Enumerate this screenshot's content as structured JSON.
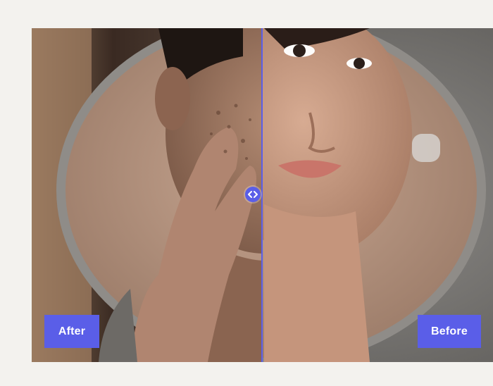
{
  "comparison": {
    "after_label": "After",
    "before_label": "Before",
    "handle_icon": "left-right-arrows-icon",
    "accent_color": "#5a5ee8",
    "split_position": 0.5
  }
}
